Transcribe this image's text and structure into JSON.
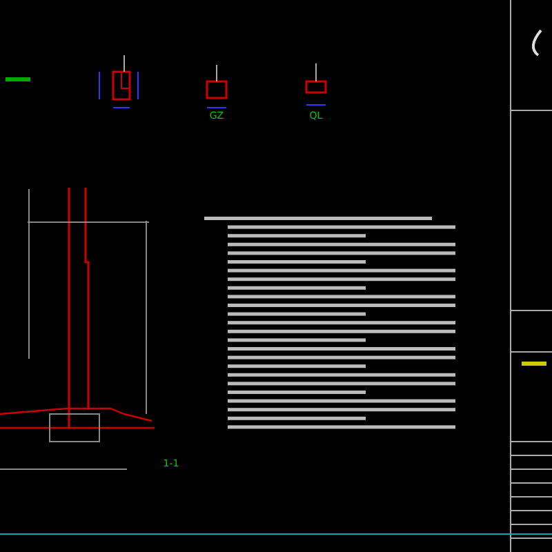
{
  "drawing": {
    "section_labels": [
      {
        "text": "GZ"
      },
      {
        "text": "QL"
      },
      {
        "text": "1-1"
      }
    ]
  }
}
